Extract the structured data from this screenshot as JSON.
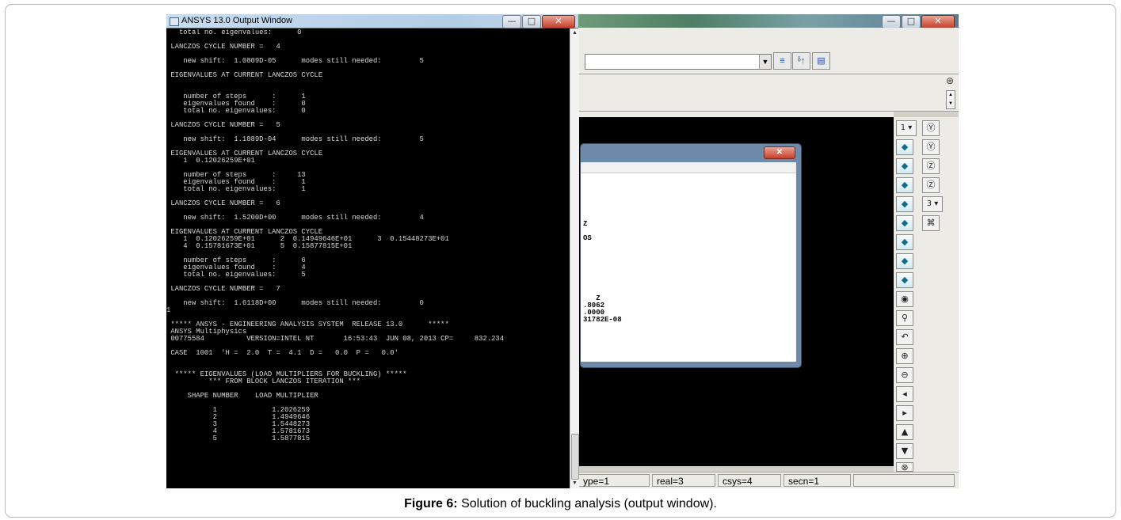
{
  "output_window": {
    "title": "ANSYS 13.0 Output Window",
    "min_glyph": "—",
    "max_glyph": "□",
    "close_glyph": "✕",
    "lines": [
      "   total no. eigenvalues:      0",
      "",
      " LANCZOS CYCLE NUMBER =   4",
      "",
      "    new shift:  1.0809D-05      modes still needed:         5",
      "",
      " EIGENVALUES AT CURRENT LANCZOS CYCLE",
      "",
      "",
      "    number of steps      :      1",
      "    eigenvalues found    :      0",
      "    total no. eigenvalues:      0",
      "",
      " LANCZOS CYCLE NUMBER =   5",
      "",
      "    new shift:  1.1889D-04      modes still needed:         5",
      "",
      " EIGENVALUES AT CURRENT LANCZOS CYCLE",
      "    1  0.12026259E+01",
      "",
      "    number of steps      :     13",
      "    eigenvalues found    :      1",
      "    total no. eigenvalues:      1",
      "",
      " LANCZOS CYCLE NUMBER =   6",
      "",
      "    new shift:  1.5200D+00      modes still needed:         4",
      "",
      " EIGENVALUES AT CURRENT LANCZOS CYCLE",
      "    1  0.12026259E+01      2  0.14949646E+01      3  0.15448273E+01",
      "    4  0.15781673E+01      5  0.15877815E+01",
      "",
      "    number of steps      :      6",
      "    eigenvalues found    :      4",
      "    total no. eigenvalues:      5",
      "",
      " LANCZOS CYCLE NUMBER =   7",
      "",
      "    new shift:  1.6118D+00      modes still needed:         0",
      "1",
      "",
      " ***** ANSYS - ENGINEERING ANALYSIS SYSTEM  RELEASE 13.0      *****",
      " ANSYS Multiphysics",
      " 00775584          VERSION=INTEL NT       16:53:43  JUN 08, 2013 CP=     832.234",
      "",
      " CASE  1001  'H =  2.0  T =  4.1  D =   0.0  P =   0.0'",
      "",
      "",
      "  ***** EIGENVALUES (LOAD MULTIPLIERS FOR BUCKLING) *****",
      "          *** FROM BLOCK LANCZOS ITERATION ***",
      "",
      "     SHAPE NUMBER    LOAD MULTIPLIER",
      "",
      "           1             1.2026259",
      "           2             1.4949646",
      "           3             1.5448273",
      "           4             1.5781673",
      "           5             1.5877815"
    ],
    "scroll_up": "▲",
    "scroll_down": "▼"
  },
  "main_window": {
    "min_glyph": "—",
    "max_glyph": "□",
    "close_glyph": "✕",
    "combo_arrow": "▼",
    "toolbar_icons": [
      "≡",
      "ᵟ↑",
      "▤"
    ],
    "collapse_glyph": "⊛",
    "spin_glyph_up": "▲",
    "spin_glyph_down": "▼"
  },
  "dialog": {
    "close_glyph": "✕",
    "lines": [
      "Z",
      "OS",
      "   Z",
      ".8062",
      ".0000",
      "31782E-08"
    ]
  },
  "right_toolbar": {
    "count_1": "1 ▾",
    "count_3": "3 ▾",
    "icons_col1": [
      "◆",
      "◆",
      "◆",
      "◆",
      "◆",
      "◆",
      "◆",
      "◆",
      "◉",
      "⚲",
      "↶",
      "⊕",
      "⊖",
      "◂",
      "▸",
      "▲",
      "▼",
      "⊗",
      "⊗"
    ],
    "icons_col2": [
      "Ⓨ",
      "Ⓨ",
      "Ⓩ",
      "Ⓩ",
      "",
      "⌘"
    ]
  },
  "status_bar": {
    "fields": [
      "ype=1",
      "real=3",
      "csys=4",
      "secn=1",
      ""
    ]
  },
  "caption": {
    "label": "Figure 6:",
    "text": " Solution of buckling analysis (output window)."
  }
}
